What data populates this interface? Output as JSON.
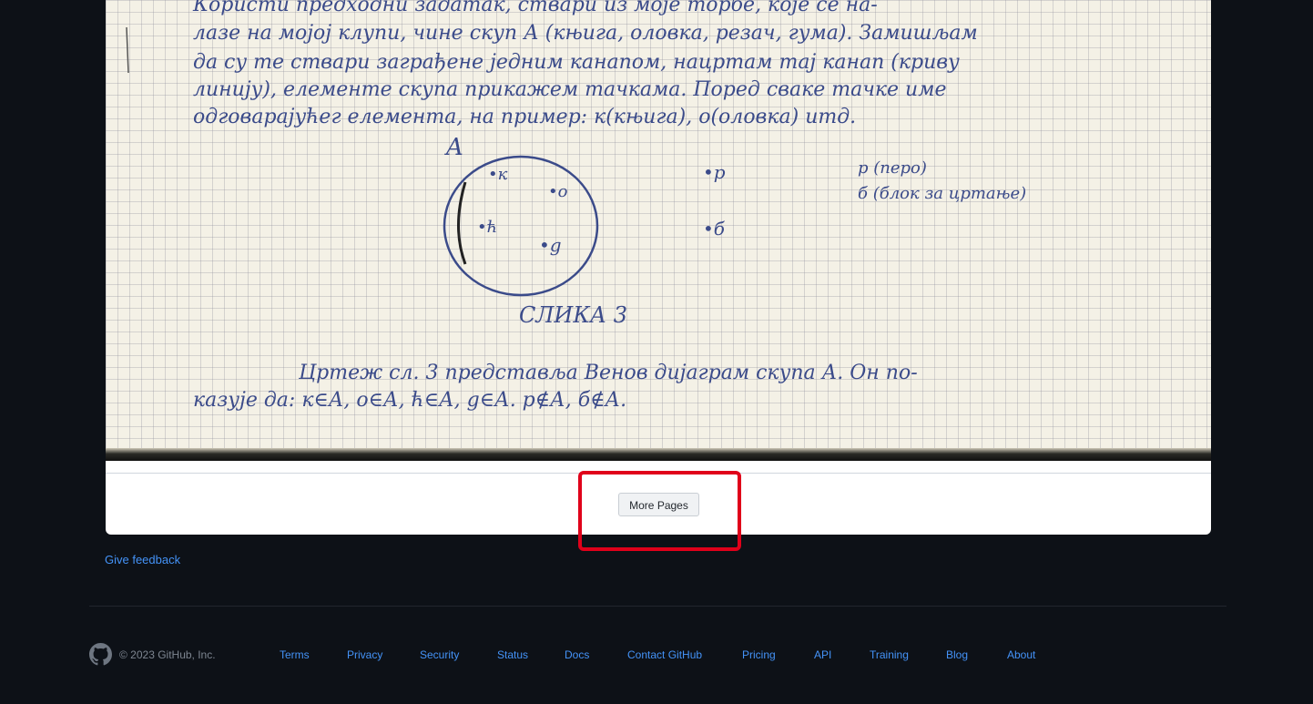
{
  "document_viewer": {
    "scan_alt": "scanned handwritten notebook page",
    "handwriting": {
      "line1": "Користи предходни задатак, ствари из моје торбе, које се на-",
      "line2": "лазе на мојој клупи, чине скуп А (књига, оловка, резач, гума). Замишљам",
      "line3": "да су те ствари заграђене једним канапом, нацртам тај канап (криву",
      "line4": "линију), елементе скупа прикажем тачкама. Поред сваке тачке име",
      "line5": "одговарајућег елемента, на пример: к(књига), о(оловка) итд.",
      "set_label": "A",
      "pt_k": "•к",
      "pt_o": "•о",
      "pt_r": "•ћ",
      "pt_g": "•g",
      "pt_p": "•p",
      "pt_b": "•б",
      "note1": "p (перо)",
      "note2": "б (блок за цртање)",
      "caption": "СЛИКА 3",
      "para1": "Цртеж сл. 3 представља Венов дијаграм скупа А. Он по-",
      "para2": "казује да: к∈А, о∈А, ћ∈А, g∈А. p∉А, б∉А."
    },
    "more_pages_label": "More Pages"
  },
  "feedback_link": "Give feedback",
  "footer": {
    "copyright": "© 2023 GitHub, Inc.",
    "links": [
      "Terms",
      "Privacy",
      "Security",
      "Status",
      "Docs",
      "Contact GitHub",
      "Pricing",
      "API",
      "Training",
      "Blog",
      "About"
    ]
  },
  "colors": {
    "page_background": "#0d1117",
    "link": "#4493f8",
    "highlight": "#e0001a",
    "ink": "#3b4b8a"
  },
  "icons": {
    "footer_logo": "github-mark-icon"
  }
}
